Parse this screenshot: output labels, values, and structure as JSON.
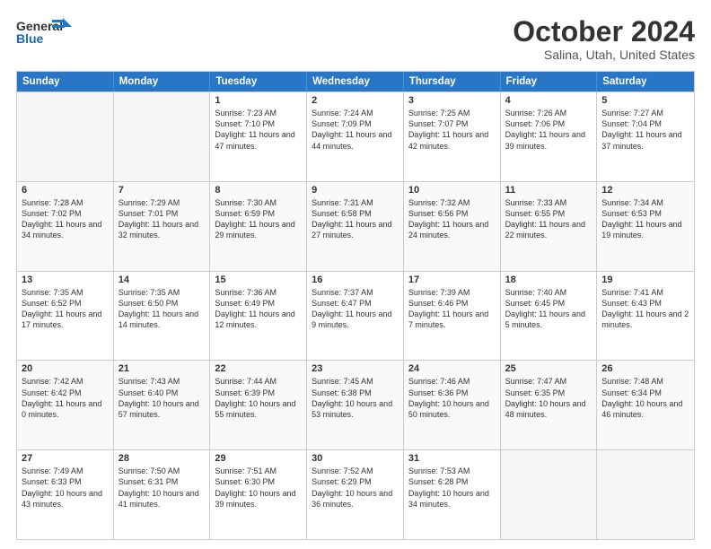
{
  "logo": {
    "line1": "General",
    "line2": "Blue"
  },
  "title": "October 2024",
  "subtitle": "Salina, Utah, United States",
  "days": [
    "Sunday",
    "Monday",
    "Tuesday",
    "Wednesday",
    "Thursday",
    "Friday",
    "Saturday"
  ],
  "rows": [
    [
      {
        "num": "",
        "text": "",
        "empty": true
      },
      {
        "num": "",
        "text": "",
        "empty": true
      },
      {
        "num": "1",
        "text": "Sunrise: 7:23 AM\nSunset: 7:10 PM\nDaylight: 11 hours and 47 minutes."
      },
      {
        "num": "2",
        "text": "Sunrise: 7:24 AM\nSunset: 7:09 PM\nDaylight: 11 hours and 44 minutes."
      },
      {
        "num": "3",
        "text": "Sunrise: 7:25 AM\nSunset: 7:07 PM\nDaylight: 11 hours and 42 minutes."
      },
      {
        "num": "4",
        "text": "Sunrise: 7:26 AM\nSunset: 7:06 PM\nDaylight: 11 hours and 39 minutes."
      },
      {
        "num": "5",
        "text": "Sunrise: 7:27 AM\nSunset: 7:04 PM\nDaylight: 11 hours and 37 minutes."
      }
    ],
    [
      {
        "num": "6",
        "text": "Sunrise: 7:28 AM\nSunset: 7:02 PM\nDaylight: 11 hours and 34 minutes."
      },
      {
        "num": "7",
        "text": "Sunrise: 7:29 AM\nSunset: 7:01 PM\nDaylight: 11 hours and 32 minutes."
      },
      {
        "num": "8",
        "text": "Sunrise: 7:30 AM\nSunset: 6:59 PM\nDaylight: 11 hours and 29 minutes."
      },
      {
        "num": "9",
        "text": "Sunrise: 7:31 AM\nSunset: 6:58 PM\nDaylight: 11 hours and 27 minutes."
      },
      {
        "num": "10",
        "text": "Sunrise: 7:32 AM\nSunset: 6:56 PM\nDaylight: 11 hours and 24 minutes."
      },
      {
        "num": "11",
        "text": "Sunrise: 7:33 AM\nSunset: 6:55 PM\nDaylight: 11 hours and 22 minutes."
      },
      {
        "num": "12",
        "text": "Sunrise: 7:34 AM\nSunset: 6:53 PM\nDaylight: 11 hours and 19 minutes."
      }
    ],
    [
      {
        "num": "13",
        "text": "Sunrise: 7:35 AM\nSunset: 6:52 PM\nDaylight: 11 hours and 17 minutes."
      },
      {
        "num": "14",
        "text": "Sunrise: 7:35 AM\nSunset: 6:50 PM\nDaylight: 11 hours and 14 minutes."
      },
      {
        "num": "15",
        "text": "Sunrise: 7:36 AM\nSunset: 6:49 PM\nDaylight: 11 hours and 12 minutes."
      },
      {
        "num": "16",
        "text": "Sunrise: 7:37 AM\nSunset: 6:47 PM\nDaylight: 11 hours and 9 minutes."
      },
      {
        "num": "17",
        "text": "Sunrise: 7:39 AM\nSunset: 6:46 PM\nDaylight: 11 hours and 7 minutes."
      },
      {
        "num": "18",
        "text": "Sunrise: 7:40 AM\nSunset: 6:45 PM\nDaylight: 11 hours and 5 minutes."
      },
      {
        "num": "19",
        "text": "Sunrise: 7:41 AM\nSunset: 6:43 PM\nDaylight: 11 hours and 2 minutes."
      }
    ],
    [
      {
        "num": "20",
        "text": "Sunrise: 7:42 AM\nSunset: 6:42 PM\nDaylight: 11 hours and 0 minutes."
      },
      {
        "num": "21",
        "text": "Sunrise: 7:43 AM\nSunset: 6:40 PM\nDaylight: 10 hours and 57 minutes."
      },
      {
        "num": "22",
        "text": "Sunrise: 7:44 AM\nSunset: 6:39 PM\nDaylight: 10 hours and 55 minutes."
      },
      {
        "num": "23",
        "text": "Sunrise: 7:45 AM\nSunset: 6:38 PM\nDaylight: 10 hours and 53 minutes."
      },
      {
        "num": "24",
        "text": "Sunrise: 7:46 AM\nSunset: 6:36 PM\nDaylight: 10 hours and 50 minutes."
      },
      {
        "num": "25",
        "text": "Sunrise: 7:47 AM\nSunset: 6:35 PM\nDaylight: 10 hours and 48 minutes."
      },
      {
        "num": "26",
        "text": "Sunrise: 7:48 AM\nSunset: 6:34 PM\nDaylight: 10 hours and 46 minutes."
      }
    ],
    [
      {
        "num": "27",
        "text": "Sunrise: 7:49 AM\nSunset: 6:33 PM\nDaylight: 10 hours and 43 minutes."
      },
      {
        "num": "28",
        "text": "Sunrise: 7:50 AM\nSunset: 6:31 PM\nDaylight: 10 hours and 41 minutes."
      },
      {
        "num": "29",
        "text": "Sunrise: 7:51 AM\nSunset: 6:30 PM\nDaylight: 10 hours and 39 minutes."
      },
      {
        "num": "30",
        "text": "Sunrise: 7:52 AM\nSunset: 6:29 PM\nDaylight: 10 hours and 36 minutes."
      },
      {
        "num": "31",
        "text": "Sunrise: 7:53 AM\nSunset: 6:28 PM\nDaylight: 10 hours and 34 minutes."
      },
      {
        "num": "",
        "text": "",
        "empty": true
      },
      {
        "num": "",
        "text": "",
        "empty": true
      }
    ]
  ]
}
